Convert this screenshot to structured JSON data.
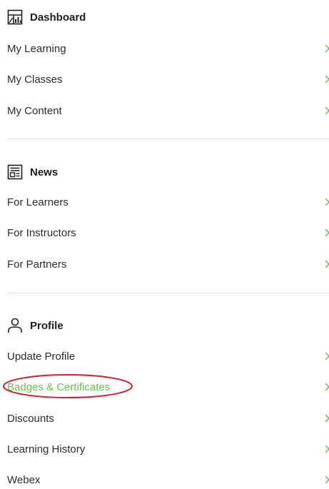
{
  "colors": {
    "text": "#2c2c2c",
    "heading": "#1f1f1f",
    "active": "#6abf4b",
    "annotation": "#d0202a",
    "divider": "#e3e3e3"
  },
  "sections": [
    {
      "title": "Dashboard",
      "icon": "dashboard-icon",
      "items": [
        {
          "label": "My Learning"
        },
        {
          "label": "My Classes"
        },
        {
          "label": "My Content"
        }
      ]
    },
    {
      "title": "News",
      "icon": "news-icon",
      "items": [
        {
          "label": "For Learners"
        },
        {
          "label": "For Instructors"
        },
        {
          "label": "For Partners"
        }
      ]
    },
    {
      "title": "Profile",
      "icon": "profile-icon",
      "items": [
        {
          "label": "Update Profile"
        },
        {
          "label": "Badges & Certificates",
          "active": true
        },
        {
          "label": "Discounts"
        },
        {
          "label": "Learning History"
        },
        {
          "label": "Webex"
        }
      ]
    }
  ]
}
